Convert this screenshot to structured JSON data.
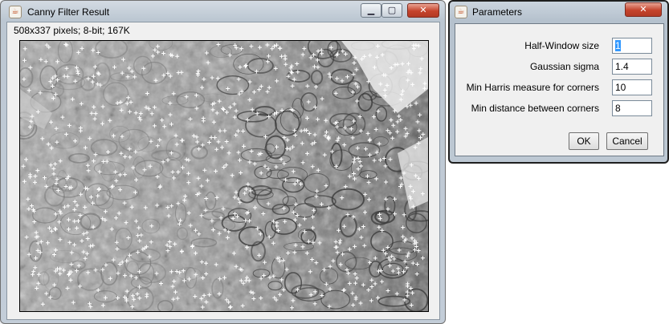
{
  "main_window": {
    "title": "Canny Filter Result",
    "info": "508x337 pixels; 8-bit; 167K",
    "icon": "java-cup-icon",
    "controls": {
      "minimize": "minimize-icon",
      "maximize": "maximize-icon",
      "close": "close-icon"
    }
  },
  "params_window": {
    "title": "Parameters",
    "icon": "java-cup-icon",
    "fields": [
      {
        "label": "Half-Window size",
        "value": "1"
      },
      {
        "label": "Gaussian sigma",
        "value": "1.4"
      },
      {
        "label": "Min Harris measure for corners",
        "value": "10"
      },
      {
        "label": "Min distance between corners",
        "value": "8"
      }
    ],
    "ok_label": "OK",
    "cancel_label": "Cancel"
  },
  "colors": {
    "selection": "#3399ff",
    "close_button": "#c5432c"
  }
}
